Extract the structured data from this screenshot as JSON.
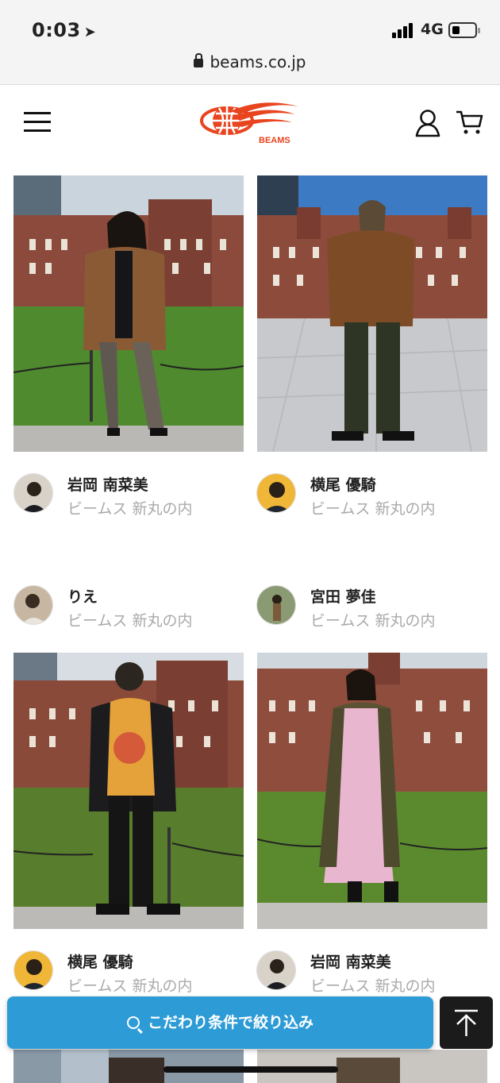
{
  "status": {
    "time": "0:03",
    "network": "4G"
  },
  "browser": {
    "url": "beams.co.jp"
  },
  "header": {
    "logo_text": "BEAMS",
    "brand_color": "#e8441f"
  },
  "staff_cards": [
    {
      "name": "岩岡 南菜美",
      "store": "ビームス 新丸の内"
    },
    {
      "name": "横尾 優騎",
      "store": "ビームス 新丸の内"
    },
    {
      "name": "りえ",
      "store": "ビームス 新丸の内"
    },
    {
      "name": "宮田 夢佳",
      "store": "ビームス 新丸の内"
    },
    {
      "name": "横尾 優騎",
      "store": "ビームス 新丸の内"
    },
    {
      "name": "岩岡 南菜美",
      "store": "ビームス 新丸の内"
    }
  ],
  "bottom": {
    "filter_label": "こだわり条件で絞り込み",
    "filter_color": "#2d9bd6"
  }
}
